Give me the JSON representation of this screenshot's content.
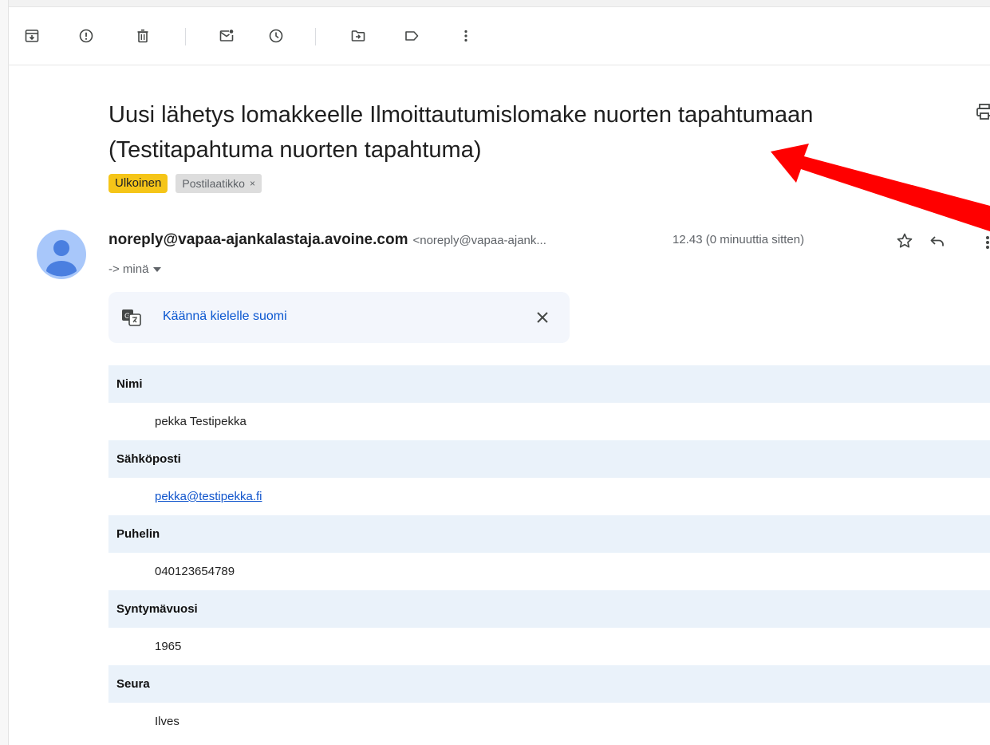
{
  "toolbar": {
    "icons": [
      "archive-icon",
      "report-spam-icon",
      "delete-icon",
      "mark-unread-icon",
      "snooze-icon",
      "move-to-icon",
      "label-icon",
      "more-vert-icon"
    ]
  },
  "email": {
    "subject": "Uusi lähetys lomakkeelle Ilmoittautumislomake nuorten tapahtumaan (Testitapahtuma nuorten tapahtuma)",
    "labels": {
      "external": "Ulkoinen",
      "inbox": "Postilaatikko",
      "inbox_remove": "×"
    },
    "sender_name": "noreply@vapaa-ajankalastaja.avoine.com",
    "sender_email": "<noreply@vapaa-ajank...",
    "time": "12.43 (0 minuuttia sitten)",
    "recipient": "-> minä"
  },
  "translate": {
    "link": "Käännä kielelle suomi"
  },
  "form": {
    "name_label": "Nimi",
    "name_value": "pekka Testipekka",
    "email_label": "Sähköposti",
    "email_value": "pekka@testipekka.fi",
    "phone_label": "Puhelin",
    "phone_value": "040123654789",
    "birthyear_label": "Syntymävuosi",
    "birthyear_value": "1965",
    "club_label": "Seura",
    "club_value": "Ilves"
  },
  "colors": {
    "label_external": "#f5c518",
    "label_inbox": "#dddddd",
    "form_header_bg": "#eaf2fa",
    "link": "#0b57d0",
    "annotation_arrow": "#ff0000"
  }
}
